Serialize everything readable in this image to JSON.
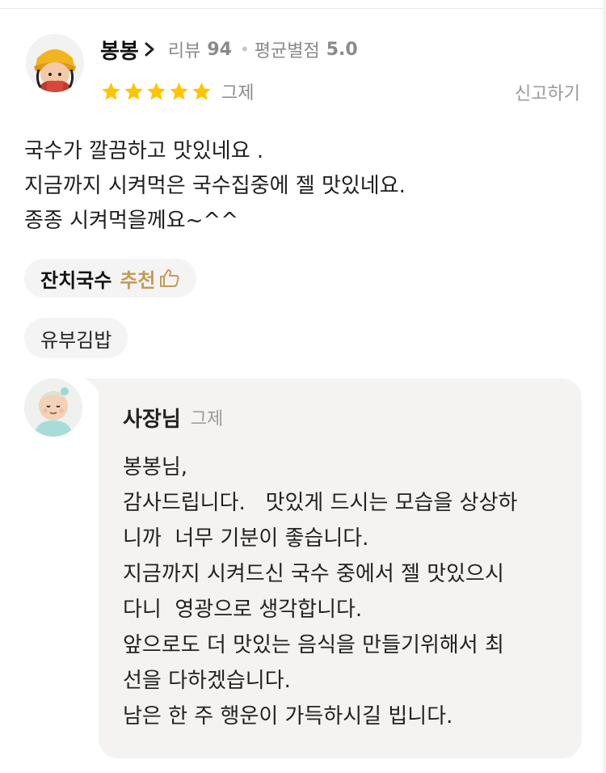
{
  "review": {
    "reviewer": {
      "name": "봉봉",
      "review_label": "리뷰",
      "review_count": "94",
      "avg_label": "평균별점",
      "avg_rating": "5.0"
    },
    "rating": 5,
    "date": "그제",
    "report_label": "신고하기",
    "body_lines": [
      "국수가 깔끔하고 맛있네요 .",
      "지금까지 시켜먹은 국수집중에 젤 맛있네요.",
      "종종 시켜먹을께요~^^"
    ],
    "menu_tags": [
      {
        "name": "잔치국수",
        "recommend_label": "추천"
      },
      {
        "name": "유부김밥"
      }
    ]
  },
  "owner_reply": {
    "name": "사장님",
    "date": "그제",
    "body_lines": [
      "봉봉님,",
      "감사드립니다.   맛있게 드시는 모습을 상상하",
      "니까  너무 기분이 좋습니다.",
      "지금까지 시켜드신 국수 중에서 젤 맛있으시",
      "다니  영광으로 생각합니다.",
      "앞으로도 더 맛있는 음식을 만들기위해서 최",
      "선을 다하겠습니다.",
      "남은 한 주 행운이 가득하시길 빕니다."
    ]
  },
  "colors": {
    "star": "#ffc400",
    "recommend": "#c59a55",
    "reply_bg": "#f4f3f1",
    "chip_bg": "#f4f4f4"
  },
  "icons": [
    "chevron-right-icon",
    "star-icon",
    "thumbs-up-icon"
  ]
}
